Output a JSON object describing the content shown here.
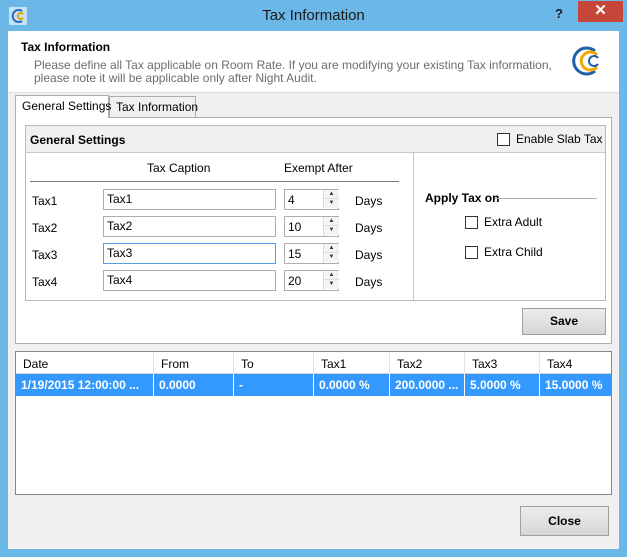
{
  "window": {
    "title": "Tax Information",
    "help": "?",
    "close": "✕"
  },
  "header": {
    "title": "Tax Information",
    "description": "Please define all Tax applicable on Room Rate. If you are modifying your existing Tax information, please note it will be applicable only after Night Audit."
  },
  "tabs": [
    {
      "label": "General Settings",
      "active": true
    },
    {
      "label": "Tax Information",
      "active": false
    }
  ],
  "general": {
    "title": "General Settings",
    "enable_slab_tax": "Enable Slab Tax",
    "col_caption": "Tax Caption",
    "col_exempt": "Exempt After",
    "rows": [
      {
        "label": "Tax1",
        "caption": "Tax1",
        "exempt": "4",
        "unit": "Days"
      },
      {
        "label": "Tax2",
        "caption": "Tax2",
        "exempt": "10",
        "unit": "Days"
      },
      {
        "label": "Tax3",
        "caption": "Tax3",
        "exempt": "15",
        "unit": "Days"
      },
      {
        "label": "Tax4",
        "caption": "Tax4",
        "exempt": "20",
        "unit": "Days"
      }
    ],
    "apply_title": "Apply Tax on",
    "extra_adult": "Extra Adult",
    "extra_child": "Extra Child",
    "save": "Save"
  },
  "grid": {
    "columns": [
      "Date",
      "From",
      "To",
      "Tax1",
      "Tax2",
      "Tax3",
      "Tax4"
    ],
    "rows": [
      [
        "1/19/2015 12:00:00 ...",
        "0.0000",
        "-",
        "0.0000 %",
        "200.0000 ...",
        "5.0000 %",
        "15.0000 %"
      ]
    ]
  },
  "footer": {
    "close": "Close"
  },
  "colors": {
    "titlebar": "#6ab7e8",
    "selection": "#3399ff",
    "close_window": "#c7463a"
  }
}
